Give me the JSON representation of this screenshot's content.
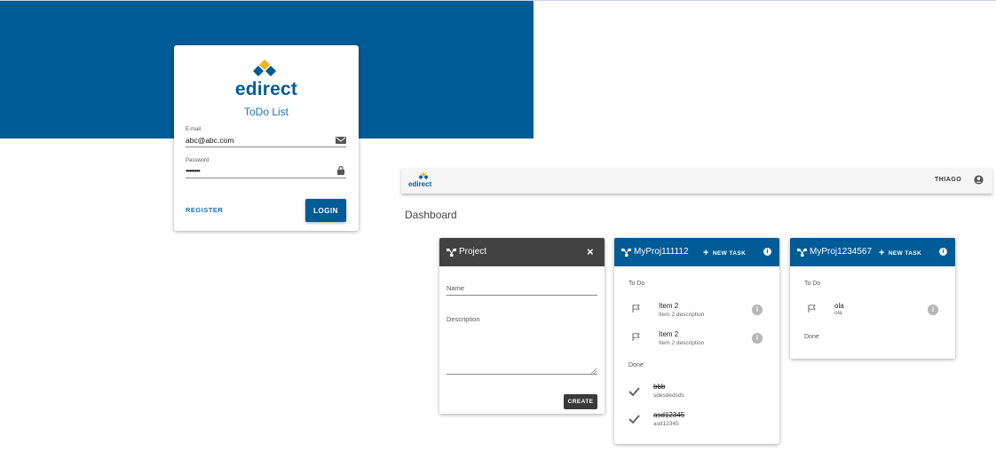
{
  "login": {
    "brand": "edirect",
    "subtitle": "ToDo List",
    "email_label": "E-mail",
    "email_value": "abc@abc.com",
    "password_label": "Password",
    "password_value": "••••••••",
    "register_label": "REGISTER",
    "login_label": "LOGIN"
  },
  "appbar": {
    "brand": "edirect",
    "username": "THIAGO"
  },
  "dashboard": {
    "title": "Dashboard",
    "new_project": {
      "title": "Project",
      "close_label": "×",
      "name_label": "Name",
      "description_label": "Description",
      "create_label": "CREATE"
    },
    "projects": [
      {
        "title": "MyProj111112",
        "new_task_label": "NEW TASK",
        "todo_label": "To Do",
        "done_label": "Done",
        "todo": [
          {
            "title": "Item 2",
            "description": "Item 2 description"
          },
          {
            "title": "Item 2",
            "description": "Item 2 description"
          }
        ],
        "done": [
          {
            "title": "bbb",
            "description": "sdesdedsds"
          },
          {
            "title": "asd12345",
            "description": "asd12345"
          }
        ]
      },
      {
        "title": "MyProj1234567",
        "new_task_label": "NEW TASK",
        "todo_label": "To Do",
        "done_label": "Done",
        "todo": [
          {
            "title": "ola",
            "description": "ola"
          }
        ],
        "done": []
      }
    ]
  },
  "colors": {
    "primary": "#005b96",
    "accent": "#f5b21b",
    "dark_header": "#424242",
    "appbar_bg": "#f5f5f5"
  }
}
